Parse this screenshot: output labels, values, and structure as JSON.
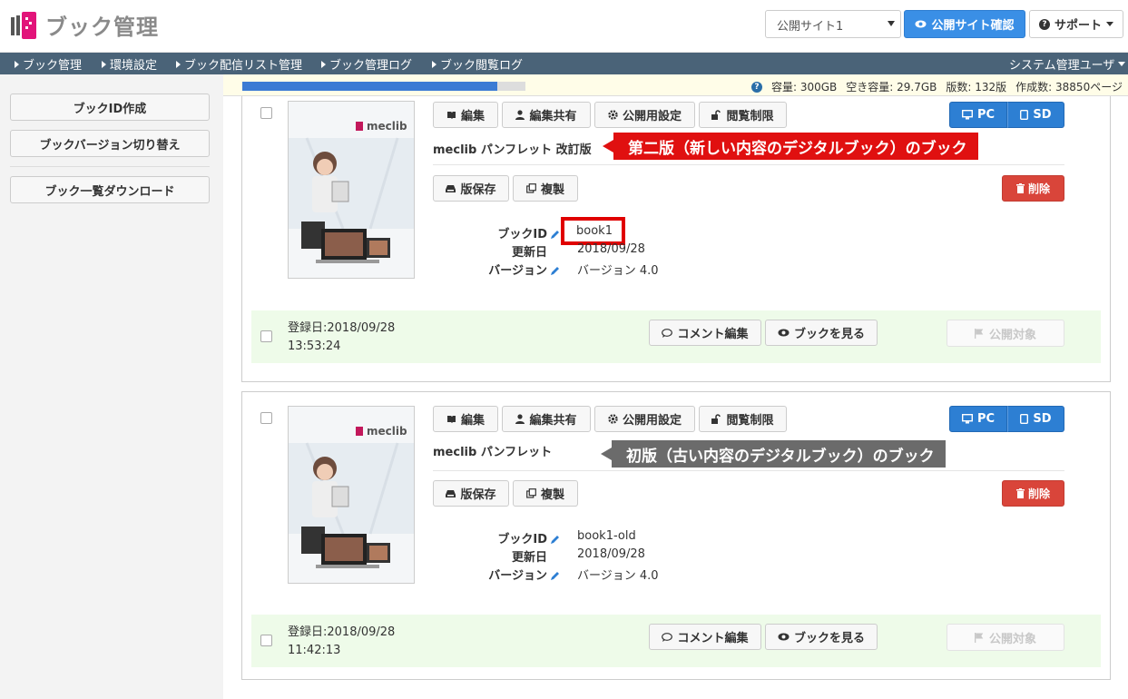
{
  "header": {
    "app_title": "ブック管理",
    "site_select_value": "公開サイト1",
    "confirm_button": "公開サイト確認",
    "support_button": "サポート"
  },
  "nav": {
    "items": [
      "ブック管理",
      "環境設定",
      "ブック配信リスト管理",
      "ブック管理ログ",
      "ブック閲覧ログ"
    ],
    "user_menu": "システム管理ユーザ"
  },
  "sidebar": {
    "create_id": "ブックID作成",
    "switch_version": "ブックバージョン切り替え",
    "download_list": "ブック一覧ダウンロード"
  },
  "status": {
    "progress_fraction": 0.9,
    "capacity": "容量: 300GB",
    "free_capacity": "空き容量: 29.7GB",
    "editions": "版数: 132版",
    "creations": "作成数: 38850ページ"
  },
  "labels": {
    "edit": "編集",
    "share_edit": "編集共有",
    "publish_settings": "公開用設定",
    "view_restrict": "閲覧制限",
    "pc": "PC",
    "sd": "SD",
    "save_version": "版保存",
    "duplicate": "複製",
    "delete": "削除",
    "book_id": "ブックID",
    "updated": "更新日",
    "version": "バージョン",
    "comment_edit": "コメント編集",
    "view_book": "ブックを見る",
    "publish_target": "公開対象",
    "cover_brand": "meclib"
  },
  "books": [
    {
      "title": "meclib パンフレット 改訂版",
      "book_id": "book1",
      "updated": "2018/09/28",
      "version": "バージョン 4.0",
      "registered_date": "登録日:2018/09/28",
      "registered_time": "13:53:24",
      "callout": "第二版（新しい内容のデジタルブック）のブック",
      "callout_color": "#e01010"
    },
    {
      "title": "meclib パンフレット",
      "book_id": "book1-old",
      "updated": "2018/09/28",
      "version": "バージョン 4.0",
      "registered_date": "登録日:2018/09/28",
      "registered_time": "11:42:13",
      "callout": "初版（古い内容のデジタルブック）のブック",
      "callout_color": "#6b6b6b"
    }
  ]
}
